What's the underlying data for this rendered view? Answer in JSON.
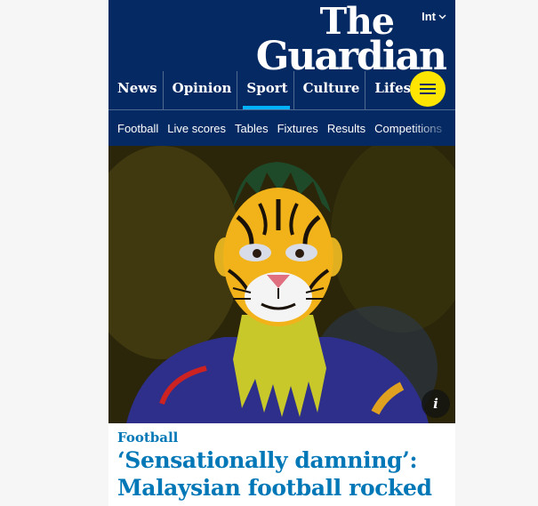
{
  "header": {
    "edition_label": "Int",
    "logo_line1": "The",
    "logo_line2": "Guardian",
    "pillars": [
      {
        "label": "News"
      },
      {
        "label": "Opinion"
      },
      {
        "label": "Sport"
      },
      {
        "label": "Culture"
      },
      {
        "label": "Lifestyle"
      }
    ],
    "active_pillar": "Sport",
    "menu_icon": "hamburger-icon",
    "accent_color": "#ffe500",
    "brand_color": "#052962"
  },
  "subnav": {
    "items": [
      {
        "label": "Football"
      },
      {
        "label": "Live scores"
      },
      {
        "label": "Tables"
      },
      {
        "label": "Fixtures"
      },
      {
        "label": "Results"
      },
      {
        "label": "Competitions"
      }
    ]
  },
  "hero": {
    "info_label": "i"
  },
  "article": {
    "kicker": "Football",
    "headline": "‘Sensationally damning’: Malaysian football rocked",
    "headline_color": "#0077b6"
  }
}
